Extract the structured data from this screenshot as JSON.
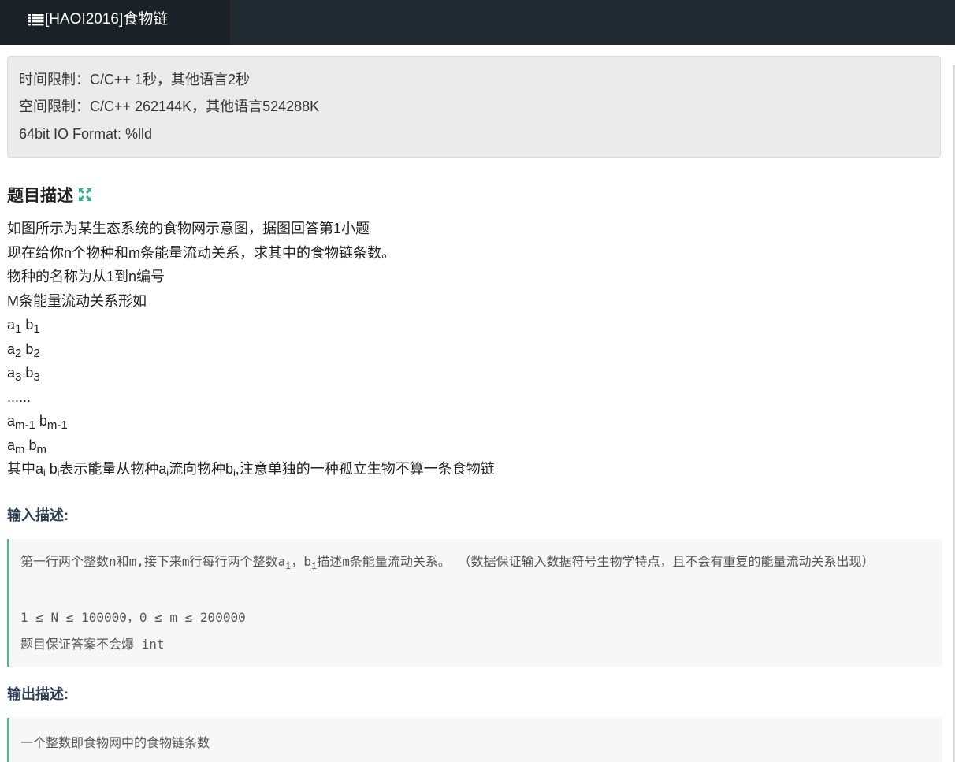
{
  "header": {
    "tab_title": "[HAOI2016]食物链"
  },
  "limits": {
    "time": "时间限制：C/C++ 1秒，其他语言2秒",
    "space": "空间限制：C/C++ 262144K，其他语言524288K",
    "format": "64bit IO Format: %lld"
  },
  "description": {
    "title": "题目描述",
    "lines": [
      "如图所示为某生态系统的食物网示意图，据图回答第1小题",
      "现在给你n个物种和m条能量流动关系，求其中的食物链条数。",
      "物种的名称为从1到n编号",
      "M条能量流动关系形如"
    ],
    "pairs": [
      {
        "a": "a",
        "a_sub": "1",
        "b": "b",
        "b_sub": "1"
      },
      {
        "a": "a",
        "a_sub": "2",
        "b": "b",
        "b_sub": "2"
      },
      {
        "a": "a",
        "a_sub": "3",
        "b": "b",
        "b_sub": "3"
      }
    ],
    "ellipsis": "......",
    "pairs_end": [
      {
        "a": "a",
        "a_sub": "m-1",
        "b": "b",
        "b_sub": "m-1"
      },
      {
        "a": "a",
        "a_sub": "m",
        "b": "b",
        "b_sub": "m"
      }
    ],
    "last_line": {
      "p1": "其中a",
      "s1": "i",
      "p2": " b",
      "s2": "i",
      "p3": "表示能量从物种a",
      "s3": "i",
      "p4": "流向物种b",
      "s4": "i",
      "p5": ",注意单独的一种孤立生物不算一条食物链"
    }
  },
  "input": {
    "title": "输入描述:",
    "line1_p1": "第一行两个整数n和m,接下来m行每行两个整数a",
    "line1_s1": "i",
    "line1_p2": "，b",
    "line1_s2": "i",
    "line1_p3": "描述m条能量流动关系。 （数据保证输入数据符号生物学特点，且不会有重复的能量流动关系出现）",
    "line2": "1 ≤ N ≤ 100000，0 ≤ m ≤ 200000",
    "line3": "题目保证答案不会爆 int"
  },
  "output": {
    "title": "输出描述:",
    "line1": "一个整数即食物网中的食物链条数"
  },
  "colors": {
    "topbar": "#222a31",
    "tab": "#1b2126",
    "accent_green": "#5cb394",
    "section_blue": "#2e3e55"
  },
  "icons": {
    "tab_icon": "list-icon",
    "expand_icon": "expand-icon"
  }
}
